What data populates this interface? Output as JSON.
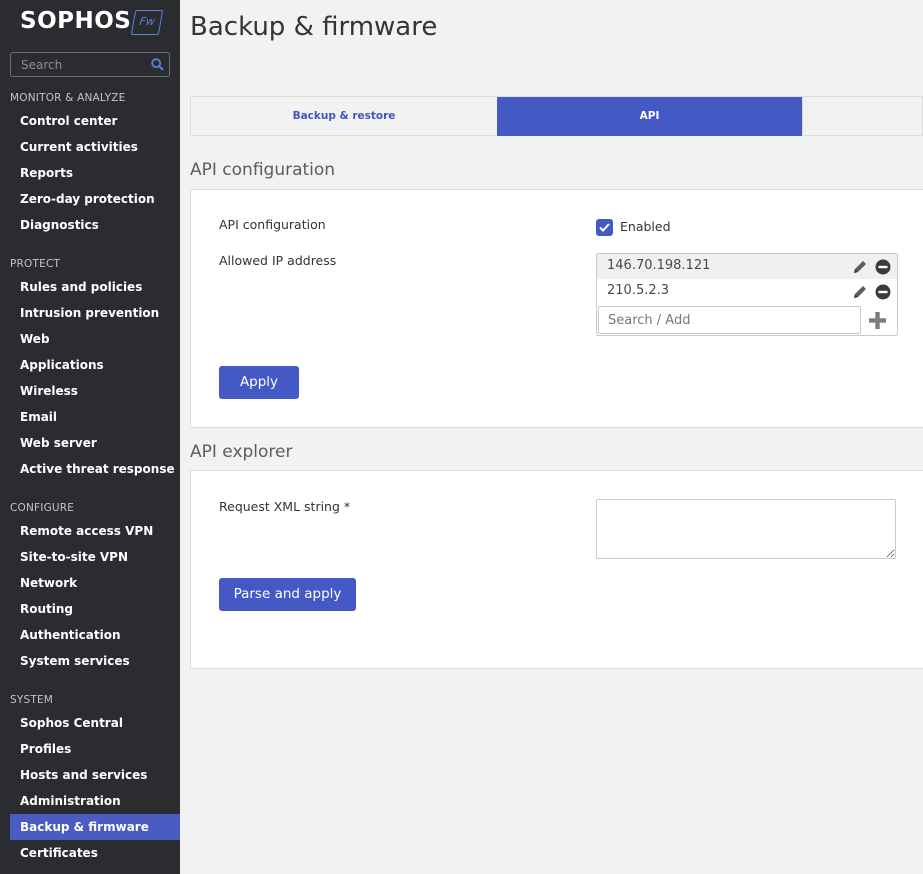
{
  "brand": {
    "name": "SOPHOS",
    "badge": "Fw"
  },
  "sidebar": {
    "search_placeholder": "Search",
    "sections": [
      {
        "title": "MONITOR & ANALYZE",
        "items": [
          "Control center",
          "Current activities",
          "Reports",
          "Zero-day protection",
          "Diagnostics"
        ]
      },
      {
        "title": "PROTECT",
        "items": [
          "Rules and policies",
          "Intrusion prevention",
          "Web",
          "Applications",
          "Wireless",
          "Email",
          "Web server",
          "Active threat response"
        ]
      },
      {
        "title": "CONFIGURE",
        "items": [
          "Remote access VPN",
          "Site-to-site VPN",
          "Network",
          "Routing",
          "Authentication",
          "System services"
        ]
      },
      {
        "title": "SYSTEM",
        "items": [
          "Sophos Central",
          "Profiles",
          "Hosts and services",
          "Administration",
          "Backup & firmware",
          "Certificates"
        ]
      }
    ],
    "active_item": "Backup & firmware"
  },
  "page": {
    "title": "Backup & firmware"
  },
  "tabs": [
    {
      "label": "Backup & restore",
      "active": false
    },
    {
      "label": "API",
      "active": true
    }
  ],
  "api_config": {
    "section_title": "API configuration",
    "config_label": "API configuration",
    "enabled_label": "Enabled",
    "enabled": true,
    "allowed_ip_label": "Allowed IP address",
    "allowed_ips": [
      "146.70.198.121",
      "210.5.2.3"
    ],
    "add_placeholder": "Search / Add",
    "apply_label": "Apply"
  },
  "api_explorer": {
    "section_title": "API explorer",
    "request_label": "Request XML string *",
    "request_value": "",
    "parse_label": "Parse and apply"
  },
  "colors": {
    "accent": "#4559c4",
    "sidebar_bg": "#2b2c30",
    "page_bg": "#f2f2f3"
  }
}
